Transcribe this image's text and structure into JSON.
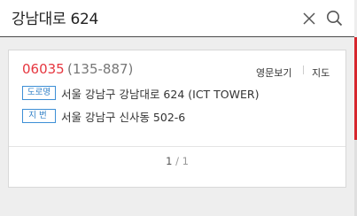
{
  "search": {
    "query": "강남대로 624"
  },
  "icons": {
    "close": "close-icon",
    "search": "search-icon"
  },
  "result": {
    "zipcode": "06035",
    "old_zipcode": "(135-887)",
    "links": {
      "english": "영문보기",
      "map": "지도"
    },
    "road_badge": "도로명",
    "road_address": "서울 강남구 강남대로 624 (ICT TOWER)",
    "jibun_badge": "지번",
    "jibun_address": "서울 강남구 신사동 502-6"
  },
  "pagination": {
    "current": "1",
    "separator": "/",
    "total": "1"
  },
  "colors": {
    "accent": "#e6363f",
    "badge": "#3d8fd6",
    "scrollbar": "#d6262d"
  }
}
